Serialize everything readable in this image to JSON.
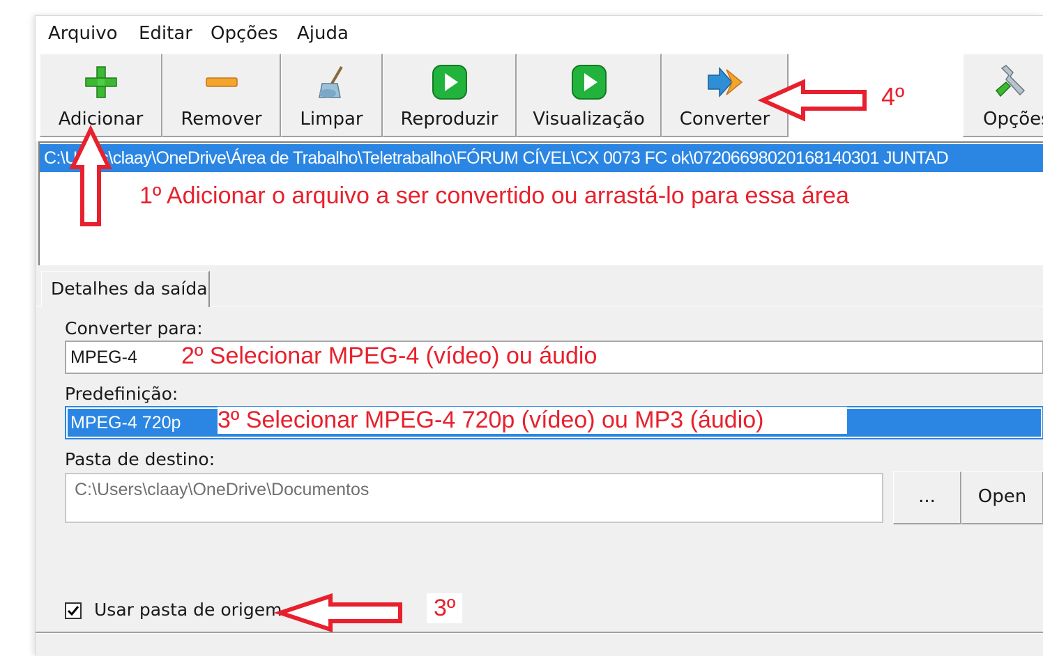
{
  "menu": [
    "Arquivo",
    "Editar",
    "Opções",
    "Ajuda"
  ],
  "toolbar": {
    "add": "Adicionar",
    "remove": "Remover",
    "clear": "Limpar",
    "play": "Reproduzir",
    "preview": "Visualização",
    "convert": "Converter",
    "options": "Opções"
  },
  "file_list": {
    "selected_path": "C:\\Users\\claay\\OneDrive\\Área de Trabalho\\Teletrabalho\\FÓRUM CÍVEL\\CX 0073 FC ok\\07206698020168140301 JUNTAD"
  },
  "tab": {
    "label": "Detalhes da saída"
  },
  "output": {
    "convert_to_label": "Converter para:",
    "convert_to_value": "MPEG-4",
    "preset_label": "Predefinição:",
    "preset_value": "MPEG-4 720p",
    "dest_label": "Pasta de destino:",
    "dest_value": "C:\\Users\\claay\\OneDrive\\Documentos",
    "browse_button": "...",
    "open_button": "Open",
    "use_source_label": "Usar pasta de origem",
    "use_source_checked": true
  },
  "annotations": {
    "step1": "1º Adicionar o arquivo a ser convertido ou arrastá-lo para essa área",
    "step2": "2º Selecionar MPEG-4 (vídeo) ou áudio",
    "step3": "3º Selecionar MPEG-4 720p (vídeo) ou MP3 (áudio)",
    "step3b": "3º",
    "step4": "4º",
    "color": "#e8202d"
  },
  "colors": {
    "selection": "#2b86e3",
    "window_bg": "#f0f0f0"
  }
}
